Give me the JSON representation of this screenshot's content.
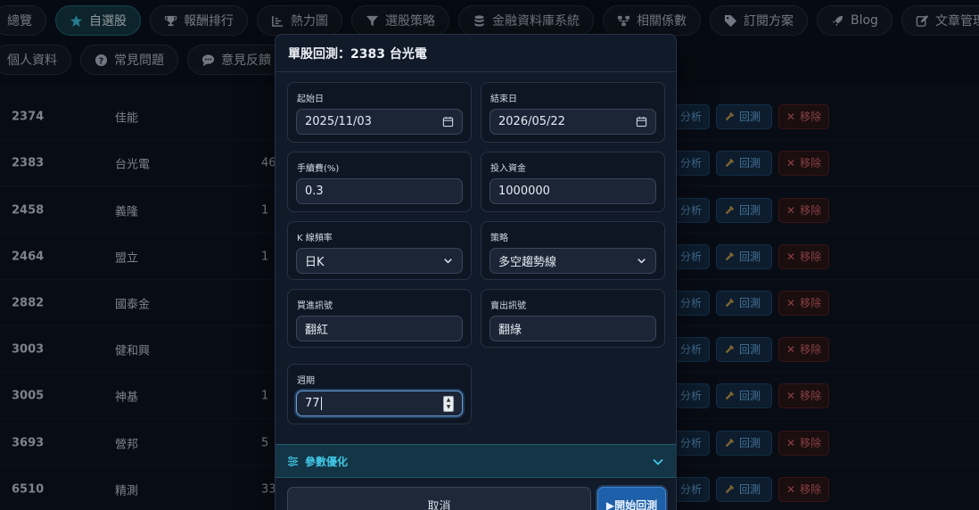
{
  "nav": {
    "row1": [
      {
        "label": "總覽",
        "icon": "none",
        "active": false
      },
      {
        "label": "自選股",
        "icon": "star-icon",
        "active": true
      },
      {
        "label": "報酬排行",
        "icon": "trophy-icon",
        "active": false
      },
      {
        "label": "熱力圖",
        "icon": "chart-icon",
        "active": false
      },
      {
        "label": "選股策略",
        "icon": "filter-icon",
        "active": false
      },
      {
        "label": "金融資料庫系統",
        "icon": "database-icon",
        "active": false
      },
      {
        "label": "相關係數",
        "icon": "network-icon",
        "active": false
      },
      {
        "label": "訂閱方案",
        "icon": "tag-icon",
        "active": false
      },
      {
        "label": "Blog",
        "icon": "rocket-icon",
        "active": false
      },
      {
        "label": "文章管理",
        "icon": "edit-icon",
        "active": false
      }
    ],
    "row2": [
      {
        "label": "個人資料",
        "icon": "none"
      },
      {
        "label": "常見問題",
        "icon": "question-icon"
      },
      {
        "label": "意見反饋",
        "icon": "comment-icon"
      },
      {
        "label": "",
        "icon": "users-icon"
      }
    ]
  },
  "table": {
    "rows": [
      {
        "code": "2374",
        "name": "佳能",
        "partial": ""
      },
      {
        "code": "2383",
        "name": "台光電",
        "partial": "46"
      },
      {
        "code": "2458",
        "name": "義隆",
        "partial": "1"
      },
      {
        "code": "2464",
        "name": "盟立",
        "partial": "1"
      },
      {
        "code": "2882",
        "name": "國泰金",
        "partial": ""
      },
      {
        "code": "3003",
        "name": "健和興",
        "partial": ""
      },
      {
        "code": "3005",
        "name": "神基",
        "partial": "1"
      },
      {
        "code": "3693",
        "name": "營邦",
        "partial": "5"
      },
      {
        "code": "6510",
        "name": "精測",
        "partial": "33"
      }
    ],
    "analyze_label": "分析",
    "backtest_label": "回測",
    "remove_label": "移除"
  },
  "modal": {
    "title": "單股回測：2383 台光電",
    "start_date": {
      "label": "起始日",
      "value": "2025/11/03"
    },
    "end_date": {
      "label": "結束日",
      "value": "2026/05/22"
    },
    "fee": {
      "label": "手續費(%)",
      "value": "0.3"
    },
    "capital": {
      "label": "投入資金",
      "value": "1000000"
    },
    "kline": {
      "label": "K 線頻率",
      "value": "日K"
    },
    "strategy": {
      "label": "策略",
      "value": "多空趨勢線"
    },
    "buy_signal": {
      "label": "買進訊號",
      "value": "翻紅"
    },
    "sell_signal": {
      "label": "賣出訊號",
      "value": "翻綠"
    },
    "period": {
      "label": "週期",
      "value": "77"
    },
    "optimize_label": "參數優化",
    "cancel_label": "取消",
    "start_label": "▶開始回測"
  },
  "colors": {
    "accent": "#3fc7e6",
    "primary_button": "#1d5fa8",
    "remove": "#e0676d"
  }
}
